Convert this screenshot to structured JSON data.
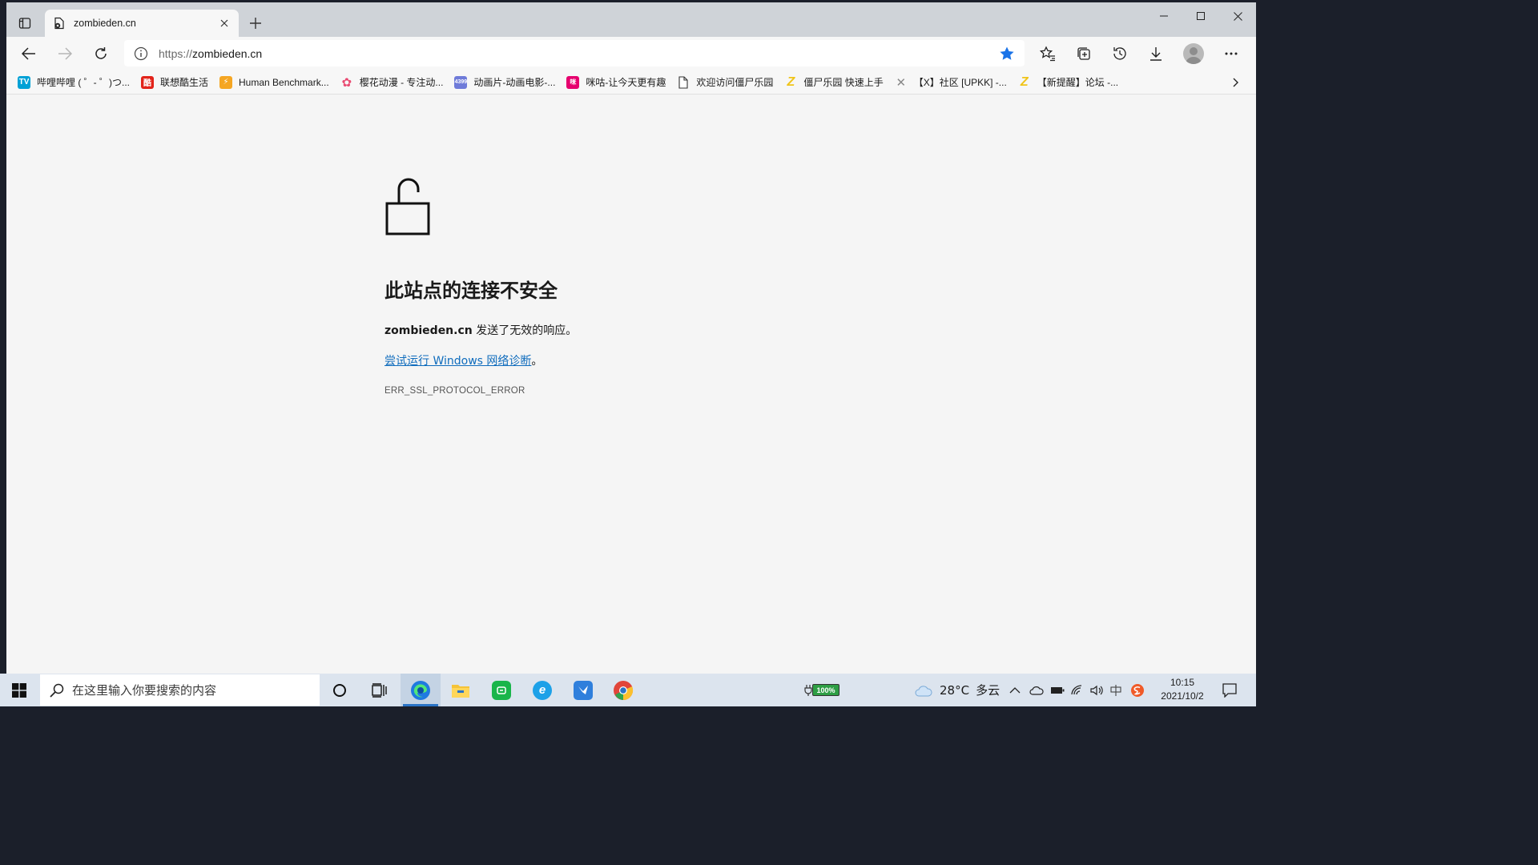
{
  "browser": {
    "tab": {
      "title": "zombieden.cn"
    },
    "address": {
      "scheme": "https://",
      "host": "zombieden.cn"
    },
    "favorites": [
      {
        "label": "哔哩哔哩 ( ゜- ゜)つ...",
        "icon": "bilibili-icon",
        "color": "#00a1d6"
      },
      {
        "label": "联想酷生活",
        "icon": "lenovo-icon",
        "color": "#e2231a"
      },
      {
        "label": "Human Benchmark...",
        "icon": "bolt-icon",
        "color": "#f5a623"
      },
      {
        "label": "樱花动漫 - 专注动...",
        "icon": "sakura-icon",
        "color": "#e94b72"
      },
      {
        "label": "动画片-动画电影-...",
        "icon": "4399-icon",
        "color": "#6f7bd9"
      },
      {
        "label": "咪咕-让今天更有趣",
        "icon": "migu-icon",
        "color": "#e6006e"
      },
      {
        "label": "欢迎访问僵尸乐园",
        "icon": "page-icon",
        "color": "#555555"
      },
      {
        "label": "僵尸乐园 快速上手",
        "icon": "z-logo-icon",
        "color": "#f0c419"
      },
      {
        "label": "【X】社区 [UPKK] -...",
        "icon": "x-logo-icon",
        "color": "#888888"
      },
      {
        "label": "【新提醒】论坛 -...",
        "icon": "z-logo-icon",
        "color": "#f0c419"
      }
    ]
  },
  "error_page": {
    "title": "此站点的连接不安全",
    "host": "zombieden.cn",
    "message_suffix": " 发送了无效的响应。",
    "link_text": "尝试运行 Windows 网络诊断",
    "link_suffix": "。",
    "error_code": "ERR_SSL_PROTOCOL_ERROR"
  },
  "taskbar": {
    "search_placeholder": "在这里输入你要搜索的内容",
    "battery_percent": "100%",
    "weather_temp": "28°C",
    "weather_desc": "多云",
    "time": "10:15",
    "date": "2021/10/2"
  },
  "colors": {
    "accent": "#0f6cbd",
    "star": "#1a73e8"
  }
}
